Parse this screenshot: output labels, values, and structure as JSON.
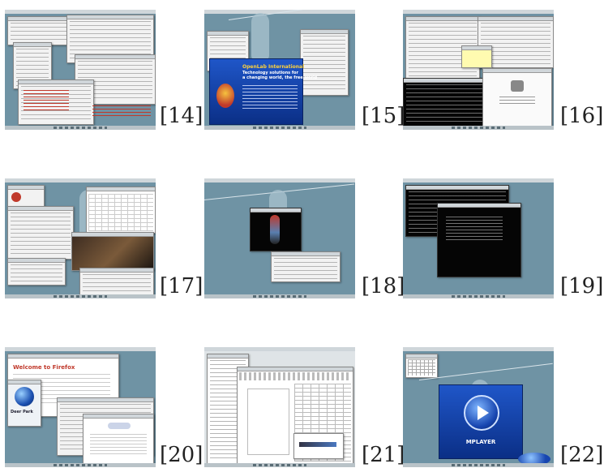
{
  "screenshots": [
    {
      "number": "[14]"
    },
    {
      "number": "[15]"
    },
    {
      "number": "[16]"
    },
    {
      "number": "[17]"
    },
    {
      "number": "[18]"
    },
    {
      "number": "[19]"
    },
    {
      "number": "[20]"
    },
    {
      "number": "[21]"
    },
    {
      "number": "[22]"
    }
  ],
  "splash": {
    "openlab_title": "OpenLab International",
    "openlab_subtitle_1": "Technology solutions for",
    "openlab_subtitle_2": "a changing world, the free world",
    "firefox_welcome": "Welcome to Firefox",
    "deer_park": "Deer Park",
    "mplayer": "MPLAYER"
  },
  "colors": {
    "desktop": "#6f93a4",
    "page_bg": "#ffffff"
  }
}
